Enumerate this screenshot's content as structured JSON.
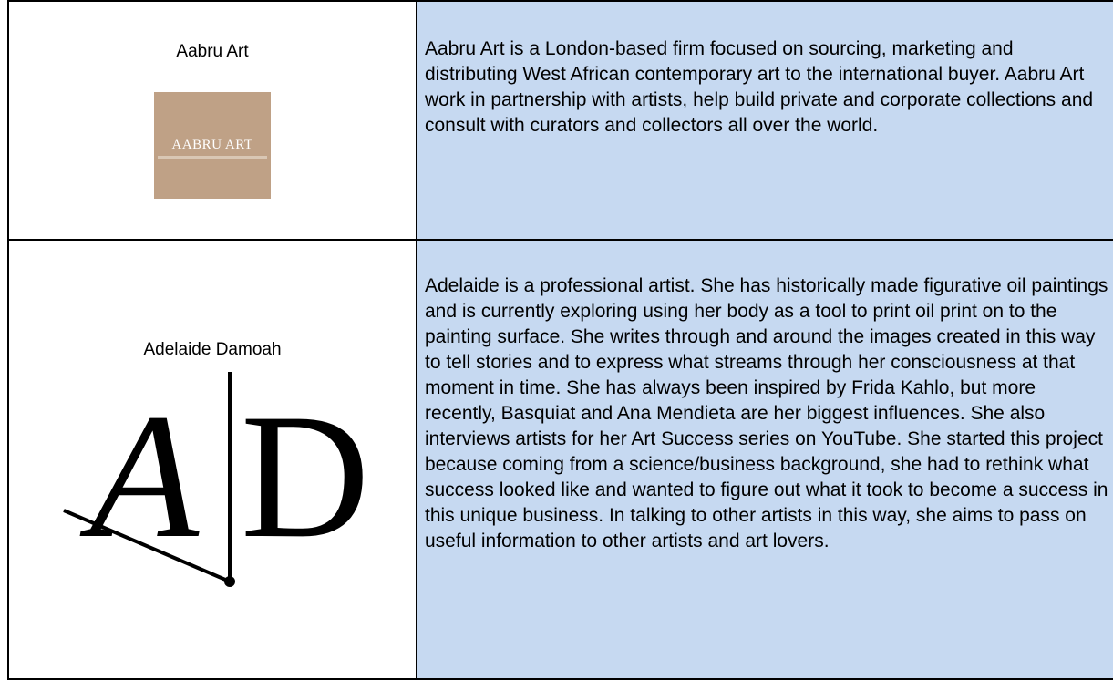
{
  "entries": [
    {
      "name": "Aabru Art",
      "logo": {
        "icon": "aabru-art-logo",
        "wordmark": "AABRU ART",
        "color": "#bfa186"
      },
      "description": "Aabru Art is a London-based firm focused on sourcing, marketing and distributing West African contemporary art to the international buyer. Aabru Art work in partnership with artists, help build private and corporate collections and consult with curators and collectors all over the world."
    },
    {
      "name": "Adelaide Damoah",
      "logo": {
        "icon": "adelaide-damoah-monogram",
        "letters": [
          "A",
          "D"
        ]
      },
      "description": "Adelaide is a professional artist. She has historically made figurative oil paintings and is currently exploring using her body as a tool to print oil print on to the painting surface. She writes through and around the images created in this way to tell stories and to express what streams through her consciousness at that moment in time. She has always been inspired by Frida Kahlo, but more recently, Basquiat and Ana Mendieta are her biggest influences. She also interviews artists for her Art Success series on YouTube. She started this project because coming from a science/business background, she had to rethink what success looked like and wanted to figure out what it took to become a success in this unique business. In talking to other artists in this way, she aims to pass on useful information to other artists and art lovers."
    }
  ],
  "colors": {
    "description_background": "#c6d9f1",
    "border": "#000000"
  }
}
